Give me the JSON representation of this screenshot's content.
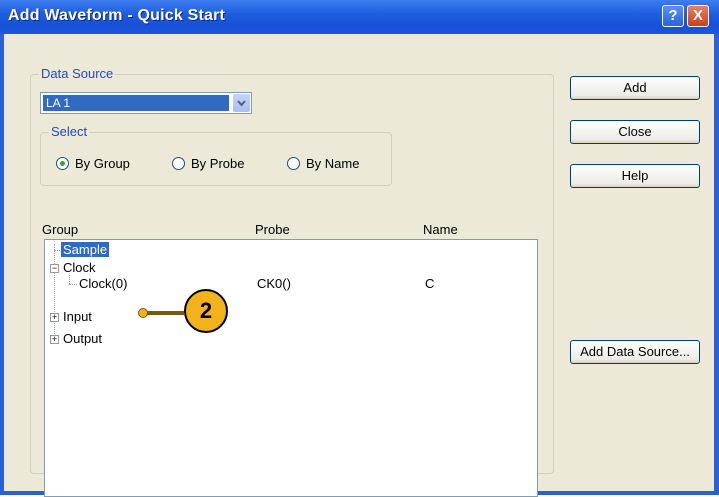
{
  "window": {
    "title": "Add Waveform - Quick Start",
    "help_glyph": "?",
    "close_glyph": "X",
    "colors": {
      "titlebar": "#1f5ee0",
      "client": "#ece9d8",
      "selection": "#316ac5",
      "callout": "#f2b21b"
    }
  },
  "data_source": {
    "label": "Data Source",
    "selected": "LA 1",
    "arrow_glyph": "⌄"
  },
  "select": {
    "label": "Select",
    "options": [
      "By Group",
      "By Probe",
      "By Name"
    ],
    "checked": "By Group"
  },
  "columns": {
    "group": "Group",
    "probe": "Probe",
    "name": "Name"
  },
  "tree": {
    "sample": "Sample",
    "clock": "Clock",
    "clock_child": {
      "group": "Clock(0)",
      "probe": "CK0()",
      "name": "C"
    },
    "input": "Input",
    "output": "Output",
    "collapse_glyph": "−",
    "expand_glyph": "+"
  },
  "buttons": {
    "add": "Add",
    "close": "Close",
    "help": "Help",
    "add_data_source": "Add Data Source..."
  },
  "callout": {
    "number": "2"
  }
}
